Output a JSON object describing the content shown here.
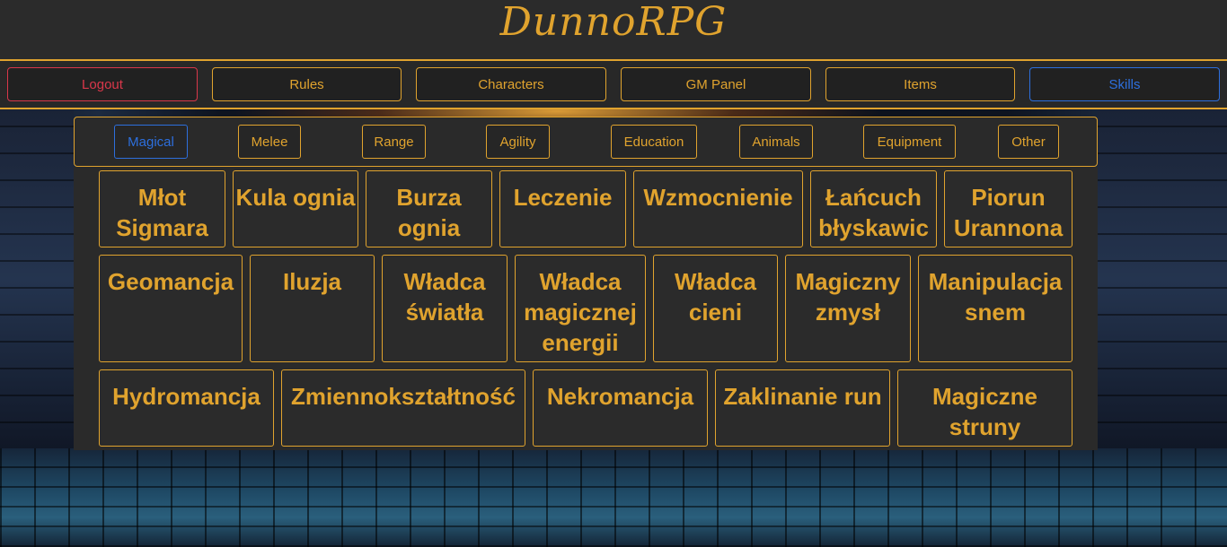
{
  "header": {
    "brand": "DunnoRPG"
  },
  "nav": [
    {
      "label": "Logout",
      "variant": "logout"
    },
    {
      "label": "Rules",
      "variant": "default"
    },
    {
      "label": "Characters",
      "variant": "default"
    },
    {
      "label": "GM Panel",
      "variant": "default"
    },
    {
      "label": "Items",
      "variant": "default"
    },
    {
      "label": "Skills",
      "variant": "active"
    }
  ],
  "categories": [
    {
      "label": "Magical",
      "active": true
    },
    {
      "label": "Melee",
      "active": false
    },
    {
      "label": "Range",
      "active": false
    },
    {
      "label": "Agility",
      "active": false
    },
    {
      "label": "Education",
      "active": false
    },
    {
      "label": "Animals",
      "active": false
    },
    {
      "label": "Equipment",
      "active": false
    },
    {
      "label": "Other",
      "active": false
    }
  ],
  "skills": {
    "row1": [
      {
        "label": "Młot Sigmara"
      },
      {
        "label": "Kula ognia"
      },
      {
        "label": "Burza ognia"
      },
      {
        "label": "Leczenie"
      },
      {
        "label": "Wzmocnienie"
      },
      {
        "label": "Łańcuch błyskawic"
      },
      {
        "label": "Piorun Urannona"
      }
    ],
    "row2": [
      {
        "label": "Geomancja"
      },
      {
        "label": "Iluzja"
      },
      {
        "label": "Władca światła"
      },
      {
        "label": "Władca magicznej energii"
      },
      {
        "label": "Władca cieni"
      },
      {
        "label": "Magiczny zmysł"
      },
      {
        "label": "Manipulacja snem"
      }
    ],
    "row3": [
      {
        "label": "Hydromancja"
      },
      {
        "label": "Zmiennokształtność"
      },
      {
        "label": "Nekromancja"
      },
      {
        "label": "Zaklinanie run"
      },
      {
        "label": "Magiczne struny"
      }
    ]
  },
  "colors": {
    "accent": "#e0a32e",
    "logout": "#d9374a",
    "active": "#2d6fdd",
    "panel": "#2a2a2a",
    "header": "#2b2b2b"
  }
}
